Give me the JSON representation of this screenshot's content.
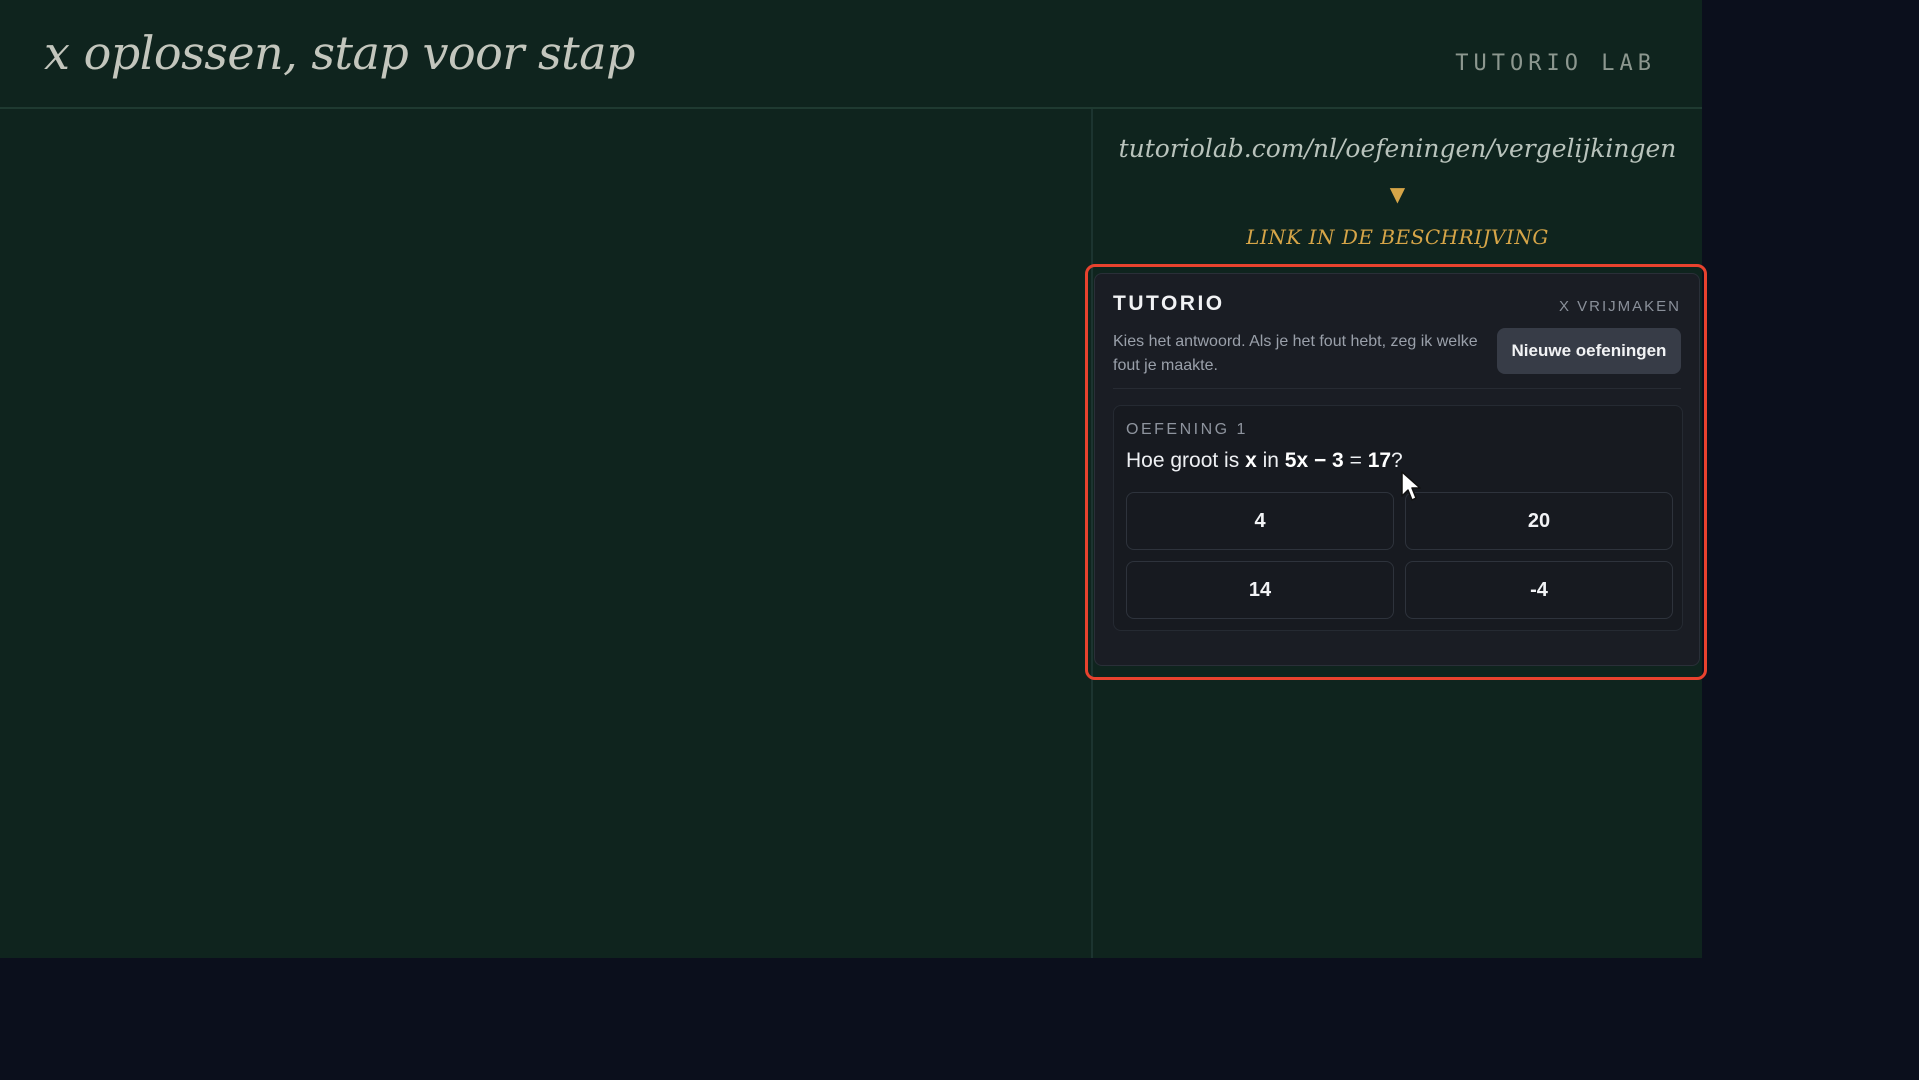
{
  "header": {
    "title": "x oplossen, stap voor stap",
    "brand": "TUTORIO LAB"
  },
  "sidebar": {
    "url": "tutoriolab.com/nl/oefeningen/vergelijkingen",
    "arrow": "▼",
    "link_hint": "LINK IN DE BESCHRIJVING"
  },
  "widget": {
    "title": "TUTORIO",
    "tag": "X VRIJMAKEN",
    "description": "Kies het antwoord. Als je het fout hebt, zeg ik welke fout je maakte.",
    "new_button": "Nieuwe oefeningen",
    "exercise": {
      "label": "OEFENING 1",
      "question": {
        "prefix": "Hoe groot is ",
        "variable": "x",
        "middle": " in ",
        "equation_left": "5x − 3",
        "equals": " = ",
        "equation_right": "17",
        "suffix": "?"
      },
      "options": [
        "4",
        "20",
        "14",
        "-4"
      ]
    }
  },
  "colors": {
    "board": "#0f241e",
    "accent": "#d6a548",
    "highlight": "#e8422e",
    "card": "#1a1d24"
  },
  "icons": {
    "cursor": "mouse-pointer-icon",
    "arrow": "arrow-down-icon"
  }
}
